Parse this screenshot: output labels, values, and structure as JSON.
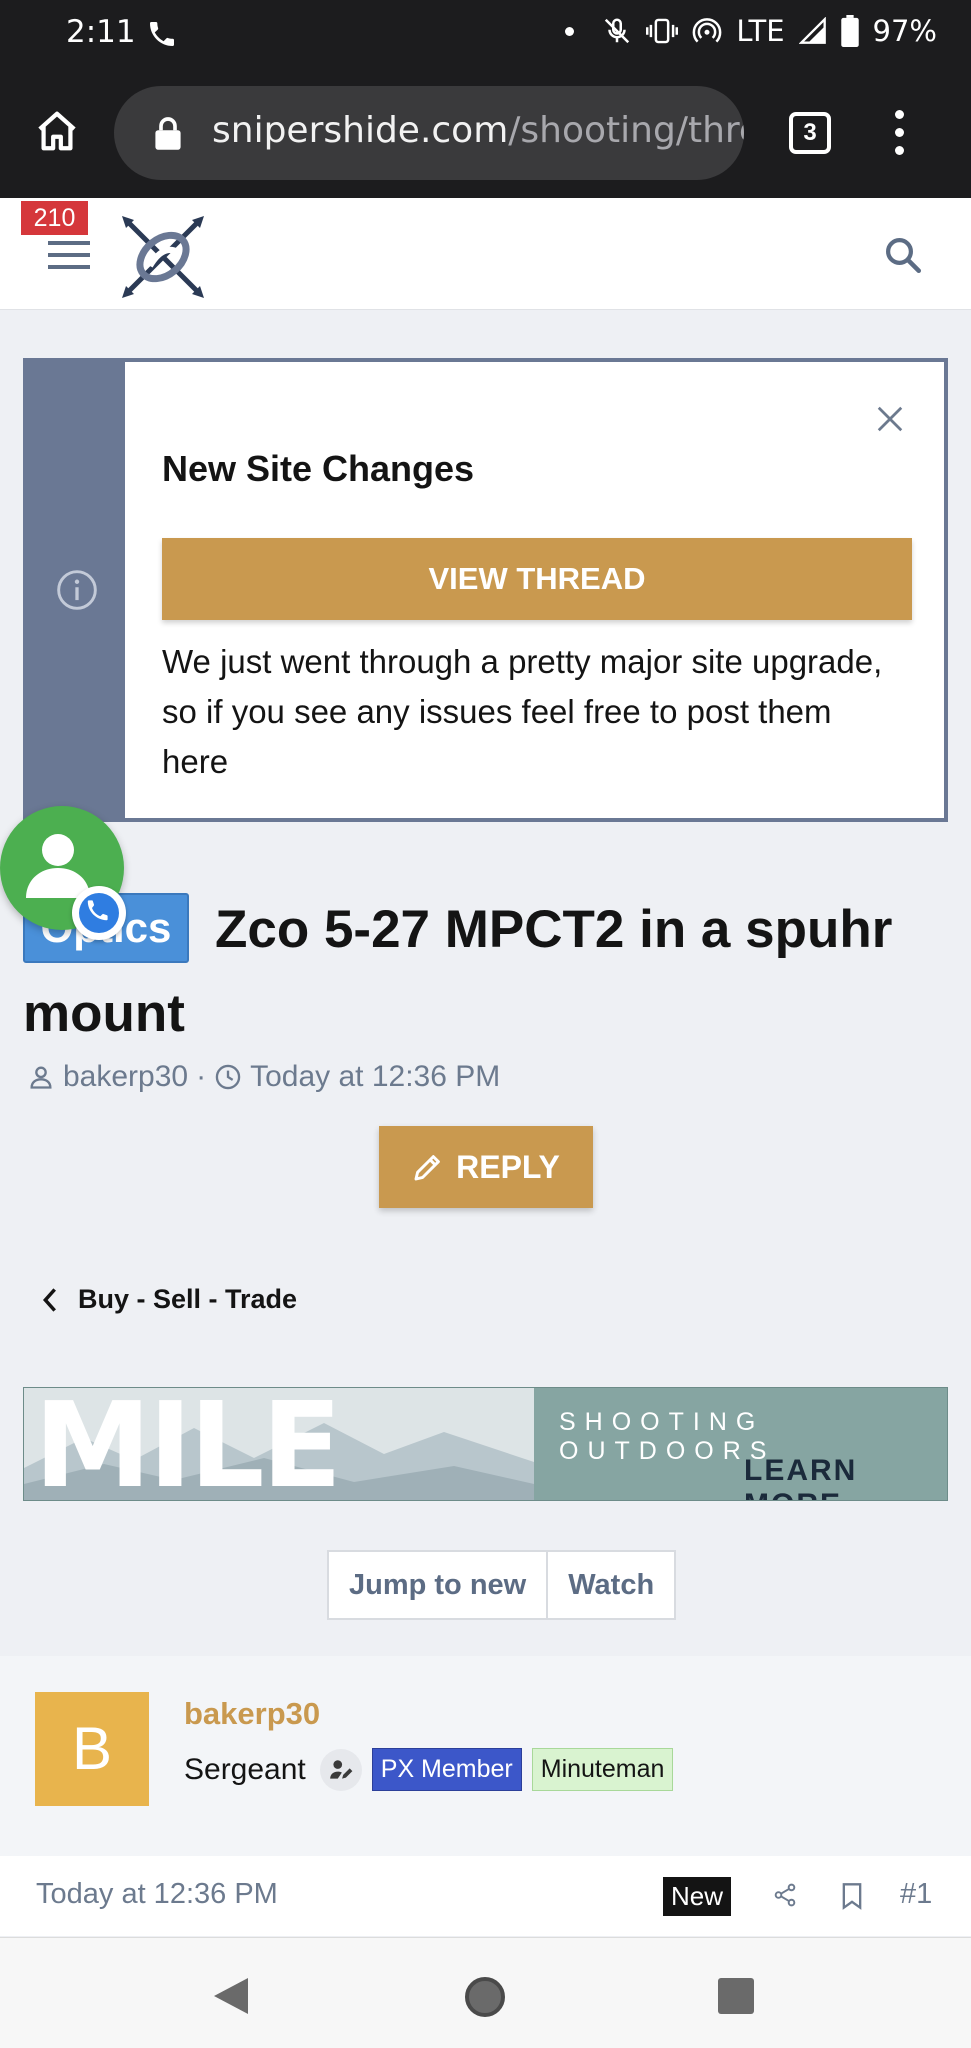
{
  "status_bar": {
    "time": "2:11",
    "network": "LTE",
    "battery": "97%"
  },
  "browser": {
    "url_host": "snipershide.com",
    "url_path": "/shooting/thre",
    "tab_count": "3"
  },
  "site_header": {
    "notification_count": "210"
  },
  "notice": {
    "title": "New Site Changes",
    "button_label": "VIEW THREAD",
    "body": "We just went through a pretty major site upgrade, so if you see any issues feel free to post them here"
  },
  "thread": {
    "prefix": "Optics",
    "title": "Zco 5-27 MPCT2 in a spuhr mount",
    "author": "bakerp30",
    "separator": "·",
    "posted": "Today at 12:36 PM",
    "reply_label": "REPLY"
  },
  "breadcrumb": {
    "label": "Buy - Sell - Trade"
  },
  "banner": {
    "headline": "MILE HIGH",
    "subline": "SHOOTING OUTDOORS",
    "cta": "LEARN MORE»"
  },
  "thread_actions": {
    "jump_label": "Jump to new",
    "watch_label": "Watch"
  },
  "post": {
    "avatar_letter": "B",
    "username": "bakerp30",
    "user_title": "Sergeant",
    "badges": [
      "PX Member",
      "Minuteman"
    ],
    "date": "Today at 12:36 PM",
    "new_label": "New",
    "post_number": "#1"
  },
  "colors": {
    "accent": "#c9994f",
    "notice_side": "#6a7894",
    "prefix_blue": "#4a90d9",
    "px_badge": "#3c57c9",
    "minuteman_badge": "#d9f3d0",
    "chat_green": "#4caf50"
  },
  "icons": {
    "home": "home-icon",
    "lock": "lock-icon",
    "menu": "more-vert-icon",
    "search": "search-icon",
    "close": "close-icon",
    "info": "info-icon",
    "pencil": "pencil-icon",
    "chevron": "chevron-left-icon",
    "share": "share-icon",
    "bookmark": "bookmark-icon"
  }
}
